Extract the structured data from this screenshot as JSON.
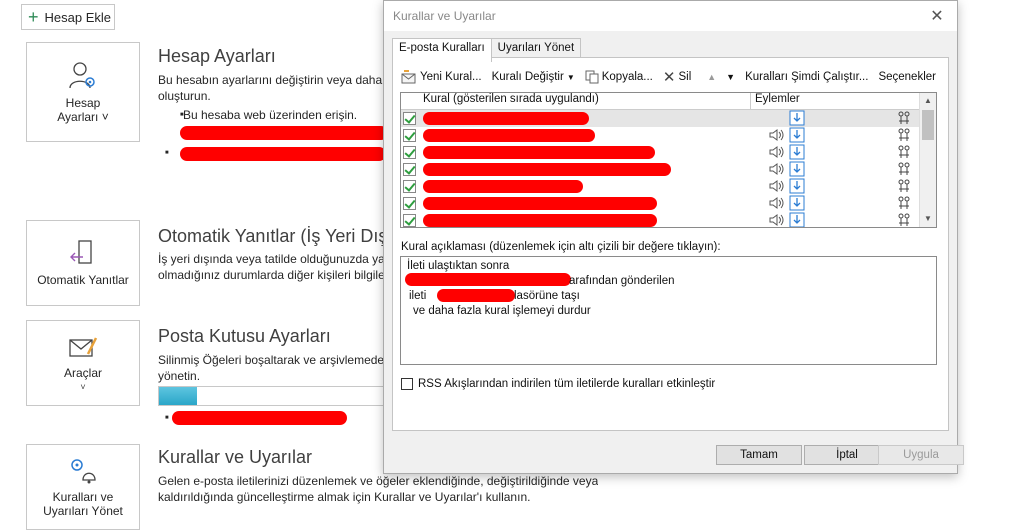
{
  "backstage": {
    "add_account_label": "Hesap Ekle",
    "sections": [
      {
        "tile_label_1": "Hesap",
        "tile_label_2": "Ayarları",
        "title": "Hesap Ayarları",
        "text_1": "Bu hesabın ayarlarını değiştirin veya daha f",
        "text_2": "oluşturun.",
        "bullet_1": "Bu hesaba web üzerinden erişin."
      },
      {
        "tile_label_1": "Otomatik Yanıtlar",
        "title": "Otomatik Yanıtlar (İş Yeri Dış",
        "text_1": "İş yeri dışında veya tatilde olduğunuzda ya",
        "text_2": "olmadığınız durumlarda diğer kişileri bilgile"
      },
      {
        "tile_label_1": "Araçlar",
        "title": "Posta Kutusu Ayarları",
        "text_1": "Silinmiş Öğeleri boşaltarak ve arşivlemeder",
        "text_2": "yönetin.",
        "mailbox_usage_fraction": 0.17
      },
      {
        "tile_label_1": "Kuralları ve",
        "tile_label_2": "Uyarıları Yönet",
        "title": "Kurallar ve Uyarılar",
        "text_1": "Gelen e-posta iletilerinizi düzenlemek ve öğeler eklendiğinde, değiştirildiğinde veya",
        "text_2": "kaldırıldığında güncelleştirme almak için Kurallar ve Uyarılar'ı kullanın."
      }
    ]
  },
  "dialog": {
    "title": "Kurallar ve Uyarılar",
    "tabs": [
      "E-posta Kuralları",
      "Uyarıları Yönet"
    ],
    "toolbar": {
      "new_rule": "Yeni Kural...",
      "change_rule": "Kuralı Değiştir",
      "copy": "Kopyala...",
      "delete": "Sil",
      "run_now": "Kuralları Şimdi Çalıştır...",
      "options": "Seçenekler"
    },
    "list_headers": {
      "rule": "Kural (gösterilen sırada uygulandı)",
      "actions": "Eylemler"
    },
    "description_label": "Kural açıklaması (düzenlemek için altı çizili bir değere tıklayın):",
    "description_lines": [
      "İleti ulaştıktan sonra",
      "arafından gönderilen",
      "ileti",
      "lasörüne taşı",
      "ve daha fazla kural işlemeyi durdur"
    ],
    "rss_label": "RSS Akışlarından indirilen tüm iletilerde kuralları etkinleştir",
    "buttons": {
      "ok": "Tamam",
      "cancel": "İptal",
      "apply": "Uygula"
    }
  },
  "colors": {
    "redaction": "#ff0000",
    "check": "#2e9e3f",
    "progress": "#2aa6c8"
  }
}
